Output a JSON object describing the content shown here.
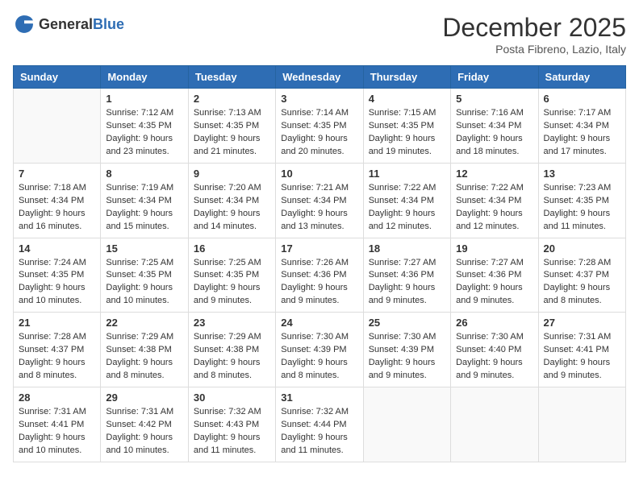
{
  "logo": {
    "general": "General",
    "blue": "Blue"
  },
  "title": "December 2025",
  "location": "Posta Fibreno, Lazio, Italy",
  "days_of_week": [
    "Sunday",
    "Monday",
    "Tuesday",
    "Wednesday",
    "Thursday",
    "Friday",
    "Saturday"
  ],
  "weeks": [
    [
      {
        "day": "",
        "sunrise": "",
        "sunset": "",
        "daylight": ""
      },
      {
        "day": "1",
        "sunrise": "7:12 AM",
        "sunset": "4:35 PM",
        "daylight": "9 hours and 23 minutes."
      },
      {
        "day": "2",
        "sunrise": "7:13 AM",
        "sunset": "4:35 PM",
        "daylight": "9 hours and 21 minutes."
      },
      {
        "day": "3",
        "sunrise": "7:14 AM",
        "sunset": "4:35 PM",
        "daylight": "9 hours and 20 minutes."
      },
      {
        "day": "4",
        "sunrise": "7:15 AM",
        "sunset": "4:35 PM",
        "daylight": "9 hours and 19 minutes."
      },
      {
        "day": "5",
        "sunrise": "7:16 AM",
        "sunset": "4:34 PM",
        "daylight": "9 hours and 18 minutes."
      },
      {
        "day": "6",
        "sunrise": "7:17 AM",
        "sunset": "4:34 PM",
        "daylight": "9 hours and 17 minutes."
      }
    ],
    [
      {
        "day": "7",
        "sunrise": "7:18 AM",
        "sunset": "4:34 PM",
        "daylight": "9 hours and 16 minutes."
      },
      {
        "day": "8",
        "sunrise": "7:19 AM",
        "sunset": "4:34 PM",
        "daylight": "9 hours and 15 minutes."
      },
      {
        "day": "9",
        "sunrise": "7:20 AM",
        "sunset": "4:34 PM",
        "daylight": "9 hours and 14 minutes."
      },
      {
        "day": "10",
        "sunrise": "7:21 AM",
        "sunset": "4:34 PM",
        "daylight": "9 hours and 13 minutes."
      },
      {
        "day": "11",
        "sunrise": "7:22 AM",
        "sunset": "4:34 PM",
        "daylight": "9 hours and 12 minutes."
      },
      {
        "day": "12",
        "sunrise": "7:22 AM",
        "sunset": "4:34 PM",
        "daylight": "9 hours and 12 minutes."
      },
      {
        "day": "13",
        "sunrise": "7:23 AM",
        "sunset": "4:35 PM",
        "daylight": "9 hours and 11 minutes."
      }
    ],
    [
      {
        "day": "14",
        "sunrise": "7:24 AM",
        "sunset": "4:35 PM",
        "daylight": "9 hours and 10 minutes."
      },
      {
        "day": "15",
        "sunrise": "7:25 AM",
        "sunset": "4:35 PM",
        "daylight": "9 hours and 10 minutes."
      },
      {
        "day": "16",
        "sunrise": "7:25 AM",
        "sunset": "4:35 PM",
        "daylight": "9 hours and 9 minutes."
      },
      {
        "day": "17",
        "sunrise": "7:26 AM",
        "sunset": "4:36 PM",
        "daylight": "9 hours and 9 minutes."
      },
      {
        "day": "18",
        "sunrise": "7:27 AM",
        "sunset": "4:36 PM",
        "daylight": "9 hours and 9 minutes."
      },
      {
        "day": "19",
        "sunrise": "7:27 AM",
        "sunset": "4:36 PM",
        "daylight": "9 hours and 9 minutes."
      },
      {
        "day": "20",
        "sunrise": "7:28 AM",
        "sunset": "4:37 PM",
        "daylight": "9 hours and 8 minutes."
      }
    ],
    [
      {
        "day": "21",
        "sunrise": "7:28 AM",
        "sunset": "4:37 PM",
        "daylight": "9 hours and 8 minutes."
      },
      {
        "day": "22",
        "sunrise": "7:29 AM",
        "sunset": "4:38 PM",
        "daylight": "9 hours and 8 minutes."
      },
      {
        "day": "23",
        "sunrise": "7:29 AM",
        "sunset": "4:38 PM",
        "daylight": "9 hours and 8 minutes."
      },
      {
        "day": "24",
        "sunrise": "7:30 AM",
        "sunset": "4:39 PM",
        "daylight": "9 hours and 8 minutes."
      },
      {
        "day": "25",
        "sunrise": "7:30 AM",
        "sunset": "4:39 PM",
        "daylight": "9 hours and 9 minutes."
      },
      {
        "day": "26",
        "sunrise": "7:30 AM",
        "sunset": "4:40 PM",
        "daylight": "9 hours and 9 minutes."
      },
      {
        "day": "27",
        "sunrise": "7:31 AM",
        "sunset": "4:41 PM",
        "daylight": "9 hours and 9 minutes."
      }
    ],
    [
      {
        "day": "28",
        "sunrise": "7:31 AM",
        "sunset": "4:41 PM",
        "daylight": "9 hours and 10 minutes."
      },
      {
        "day": "29",
        "sunrise": "7:31 AM",
        "sunset": "4:42 PM",
        "daylight": "9 hours and 10 minutes."
      },
      {
        "day": "30",
        "sunrise": "7:32 AM",
        "sunset": "4:43 PM",
        "daylight": "9 hours and 11 minutes."
      },
      {
        "day": "31",
        "sunrise": "7:32 AM",
        "sunset": "4:44 PM",
        "daylight": "9 hours and 11 minutes."
      },
      {
        "day": "",
        "sunrise": "",
        "sunset": "",
        "daylight": ""
      },
      {
        "day": "",
        "sunrise": "",
        "sunset": "",
        "daylight": ""
      },
      {
        "day": "",
        "sunrise": "",
        "sunset": "",
        "daylight": ""
      }
    ]
  ]
}
